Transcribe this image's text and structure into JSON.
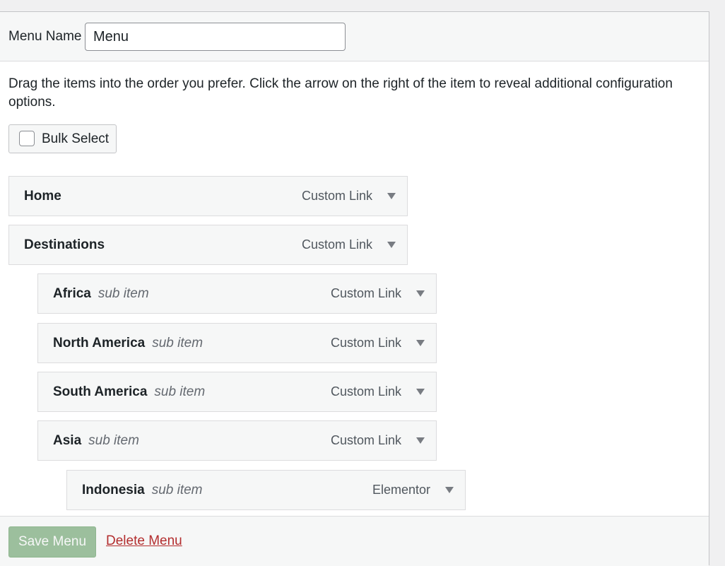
{
  "menu_name": {
    "label": "Menu Name",
    "value": "Menu"
  },
  "instructions": "Drag the items into the order you prefer. Click the arrow on the right of the item to reveal additional configuration options.",
  "bulk_select": {
    "label": "Bulk Select",
    "checked": false
  },
  "items": [
    {
      "name": "Home",
      "sub": "",
      "type": "Custom Link",
      "depth": 0
    },
    {
      "name": "Destinations",
      "sub": "",
      "type": "Custom Link",
      "depth": 0
    },
    {
      "name": "Africa",
      "sub": "sub item",
      "type": "Custom Link",
      "depth": 1
    },
    {
      "name": "North America",
      "sub": "sub item",
      "type": "Custom Link",
      "depth": 1
    },
    {
      "name": "South America",
      "sub": "sub item",
      "type": "Custom Link",
      "depth": 1
    },
    {
      "name": "Asia",
      "sub": "sub item",
      "type": "Custom Link",
      "depth": 1
    },
    {
      "name": "Indonesia",
      "sub": "sub item",
      "type": "Elementor",
      "depth": 2
    }
  ],
  "footer": {
    "save_label": "Save Menu",
    "delete_label": "Delete Menu"
  },
  "icons": {
    "item_toggle": "triangle-down-icon"
  },
  "colors": {
    "save_button_bg": "#9cbf9d",
    "delete_link": "#b32d2e"
  }
}
